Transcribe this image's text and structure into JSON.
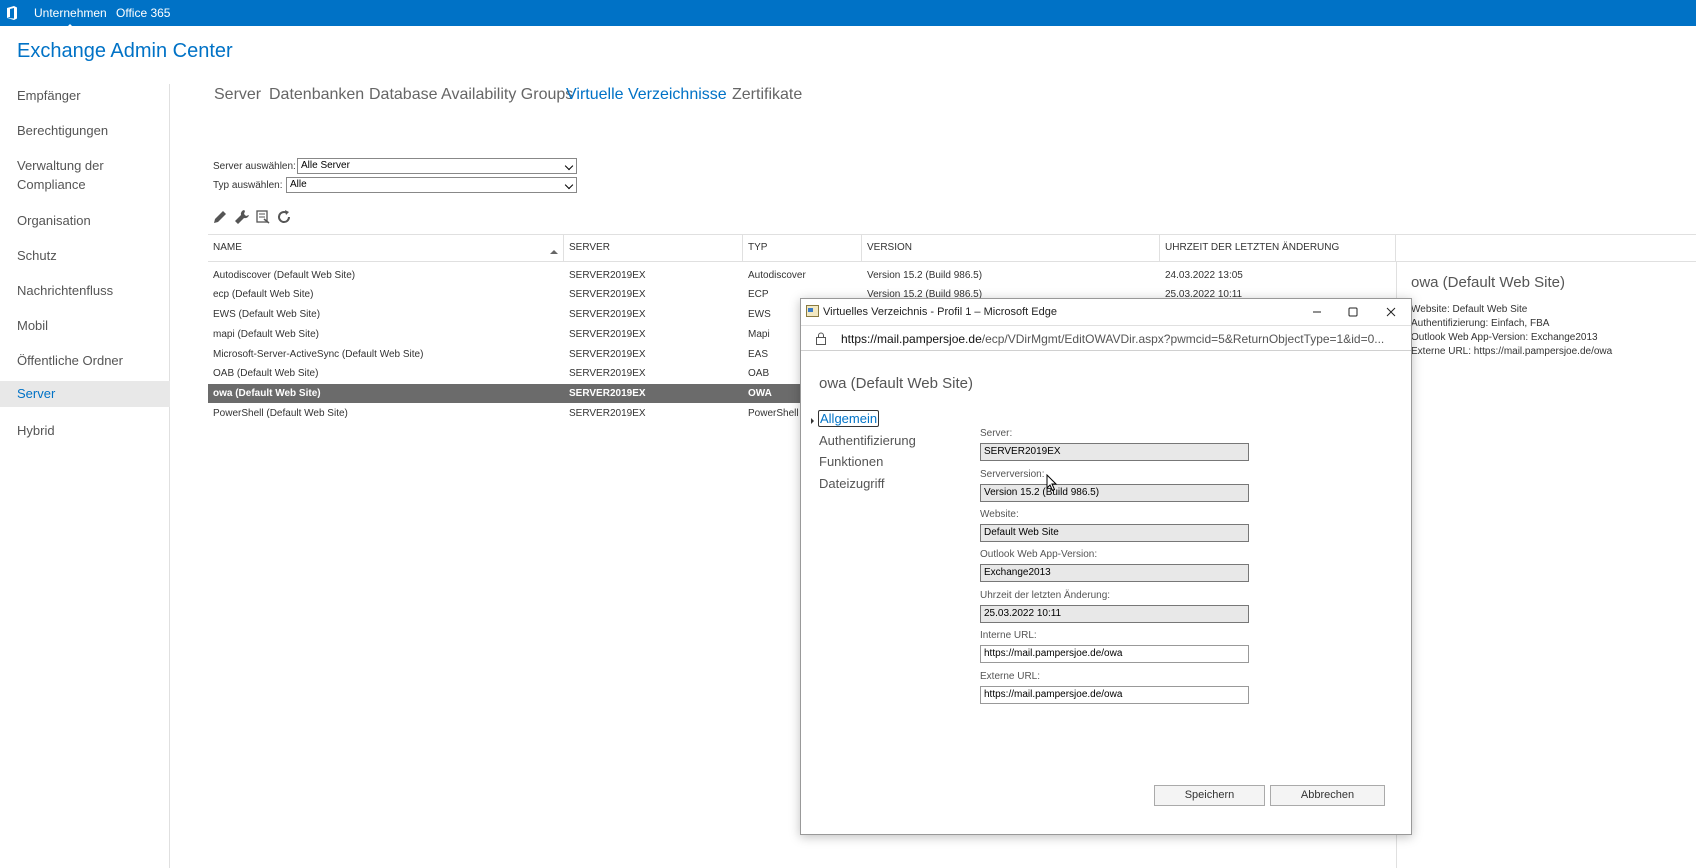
{
  "topbar": {
    "tabs": [
      "Unternehmen",
      "Office 365"
    ],
    "active_tab": "Unternehmen",
    "logo_icon": "office-logo-icon"
  },
  "app": {
    "title": "Exchange Admin Center"
  },
  "leftnav": {
    "items": [
      "Empfänger",
      "Berechtigungen",
      "Verwaltung der",
      "Compliance",
      "Organisation",
      "Schutz",
      "Nachrichtenfluss",
      "Mobil",
      "Öffentliche Ordner",
      "Server",
      "Hybrid"
    ],
    "active": "Server"
  },
  "subtabs": {
    "items": [
      "Server",
      "Datenbanken",
      "Database Availability Groups",
      "Virtuelle Verzeichnisse",
      "Zertifikate"
    ],
    "active": "Virtuelle Verzeichnisse"
  },
  "filters": {
    "server_label": "Server auswählen:",
    "server_value": "Alle Server",
    "type_label": "Typ auswählen:",
    "type_value": "Alle"
  },
  "toolbar": {
    "icons": [
      "edit-icon",
      "wrench-icon",
      "reset-icon",
      "refresh-icon"
    ]
  },
  "table": {
    "columns": [
      "NAME",
      "SERVER",
      "TYP",
      "VERSION",
      "UHRZEIT DER LETZTEN ÄNDERUNG"
    ],
    "rows": [
      [
        "Autodiscover (Default Web Site)",
        "SERVER2019EX",
        "Autodiscover",
        "Version 15.2 (Build 986.5)",
        "24.03.2022 13:05"
      ],
      [
        "ecp (Default Web Site)",
        "SERVER2019EX",
        "ECP",
        "Version 15.2 (Build 986.5)",
        "25.03.2022 10:11"
      ],
      [
        "EWS (Default Web Site)",
        "SERVER2019EX",
        "EWS",
        "",
        ""
      ],
      [
        "mapi (Default Web Site)",
        "SERVER2019EX",
        "Mapi",
        "",
        ""
      ],
      [
        "Microsoft-Server-ActiveSync (Default Web Site)",
        "SERVER2019EX",
        "EAS",
        "",
        ""
      ],
      [
        "OAB (Default Web Site)",
        "SERVER2019EX",
        "OAB",
        "",
        ""
      ],
      [
        "owa (Default Web Site)",
        "SERVER2019EX",
        "OWA",
        "",
        ""
      ],
      [
        "PowerShell (Default Web Site)",
        "SERVER2019EX",
        "PowerShell",
        "",
        ""
      ]
    ],
    "selected_row": "owa (Default Web Site)"
  },
  "details": {
    "title": "owa (Default Web Site)",
    "lines": [
      "Website: Default Web Site",
      "Authentifizierung: Einfach, FBA",
      "Outlook Web App-Version: Exchange2013",
      "Externe URL: https://mail.pampersjoe.de/owa"
    ]
  },
  "dialog": {
    "window_title": "Virtuelles Verzeichnis - Profil 1 – Microsoft Edge",
    "url_host": "https://mail.pampersjoe.de",
    "url_path": "/ecp/VDirMgmt/EditOWAVDir.aspx?pwmcid=5&ReturnObjectType=1&id=0...",
    "heading": "owa (Default Web Site)",
    "nav": [
      "Allgemein",
      "Authentifizierung",
      "Funktionen",
      "Dateizugriff"
    ],
    "active_nav": "Allgemein",
    "fields": [
      {
        "label": "Server:",
        "value": "SERVER2019EX",
        "readonly": true
      },
      {
        "label": "Serverversion:",
        "value": "Version 15.2 (Build 986.5)",
        "readonly": true
      },
      {
        "label": "Website:",
        "value": "Default Web Site",
        "readonly": true
      },
      {
        "label": "Outlook Web App-Version:",
        "value": "Exchange2013",
        "readonly": true
      },
      {
        "label": "Uhrzeit der letzten Änderung:",
        "value": "25.03.2022 10:11",
        "readonly": true
      },
      {
        "label": "Interne URL:",
        "value": "https://mail.pampersjoe.de/owa",
        "readonly": false
      },
      {
        "label": "Externe URL:",
        "value": "https://mail.pampersjoe.de/owa",
        "readonly": false
      }
    ],
    "save_label": "Speichern",
    "cancel_label": "Abbrechen"
  },
  "colors": {
    "accent": "#0072c6",
    "selected_row": "#6b6b6b",
    "readonly_field": "#e8e8e8"
  }
}
